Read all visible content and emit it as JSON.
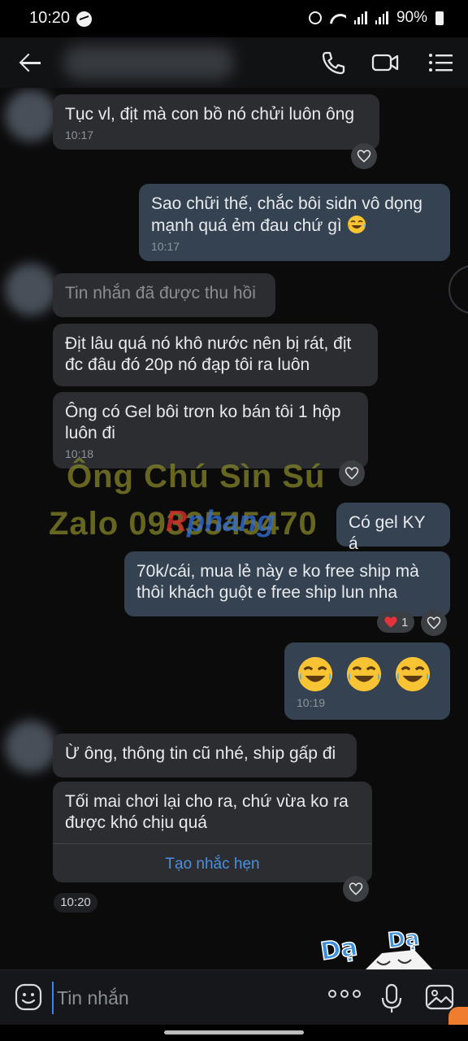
{
  "status_bar": {
    "time": "10:20",
    "battery": "90%"
  },
  "header": {
    "contact_name": ""
  },
  "messages": [
    {
      "side": "in",
      "text": "Tục vl, địt mà con bồ nó chửi luôn ông",
      "time": "10:17"
    },
    {
      "side": "out",
      "text": "Sao chữi thế, chắc bôi sidn vô dọng mạnh quá ẻm đau chứ gì",
      "time": "10:17"
    },
    {
      "side": "in",
      "text": "Tin nhắn đã được thu hồi"
    },
    {
      "side": "in",
      "text": "Địt lâu quá nó khô nước nên bị rát, địt đc đâu đó 20p nó đạp tôi ra luôn"
    },
    {
      "side": "in",
      "text": "Ông có Gel bôi trơn ko bán tôi 1 hộp luôn đi",
      "time": "10:18"
    },
    {
      "side": "out",
      "text": "Có gel KY á"
    },
    {
      "side": "out",
      "text": "70k/cái, mua lẻ này e ko free ship mà thôi khách guột e free ship lun nha",
      "reaction_count": "1"
    },
    {
      "side": "out",
      "text": "",
      "time": "10:19",
      "emoji_count": 3
    },
    {
      "side": "in",
      "text": "Ừ ông, thông tin cũ nhé, ship gấp đi"
    },
    {
      "side": "in",
      "text": "Tối mai chơi lại cho ra, chứ vừa ko ra được khó chịu quá",
      "action": "Tạo nhắc hẹn"
    }
  ],
  "time_separator": "10:20",
  "watermark": {
    "line1": "Ông Chú Sìn Sú",
    "line2": "Zalo 0933545470",
    "brand_red": "R",
    "brand_blue": "phang"
  },
  "sticker": {
    "text": "Dạ Dạ"
  },
  "composer": {
    "placeholder": "Tin nhắn"
  },
  "colors": {
    "incoming_bubble": "#2b2d31",
    "outgoing_bubble": "#344251",
    "link": "#4b8fe0",
    "background": "#0b0b0c"
  }
}
